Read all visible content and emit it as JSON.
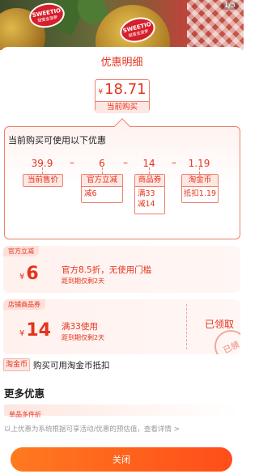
{
  "photo": {
    "brand_sticker_text": "SWEETIO",
    "brand_sticker_sub": "甜蜜金菠萝",
    "counter": "1/5"
  },
  "sheet": {
    "title": "优惠明细",
    "current_price": {
      "currency": "¥",
      "amount": "18.71",
      "caption": "当前购买"
    }
  },
  "breakdown": {
    "title": "当前购买可使用以下优惠",
    "values": [
      "39.9",
      "6",
      "14",
      "1.19"
    ],
    "operator": "–",
    "chips": {
      "price": "当前售价",
      "official": {
        "head": "官方立减",
        "line1": "减6"
      },
      "store": {
        "head": "商品券",
        "line1": "满33",
        "line2": "减14"
      },
      "coin": {
        "head": "淘金币",
        "line1": "抵扣1.19"
      }
    }
  },
  "card_official": {
    "tag": "官方立减",
    "currency": "¥",
    "amount": "6",
    "desc": "官方8.5折，无使用门槛",
    "expiry": "距到期仅剩2天"
  },
  "card_store": {
    "tag": "店铺商品券",
    "currency": "¥",
    "amount": "14",
    "desc": "满33使用",
    "expiry": "距到期仅剩2天",
    "status": "已领取",
    "stamp": "已领"
  },
  "taojin": {
    "badge": "淘金币",
    "text": "购买可用淘金币抵扣"
  },
  "more": {
    "title": "更多优惠",
    "multi_tag": "单品多件折"
  },
  "footnote": {
    "text": "以上优惠为系统根据可享活动/优惠的预估值，查看详情",
    "arrow": ">"
  },
  "close_label": "关闭",
  "colors": {
    "accent": "#e5331d",
    "button_start": "#ff7a1f",
    "button_end": "#ff4d1a"
  }
}
